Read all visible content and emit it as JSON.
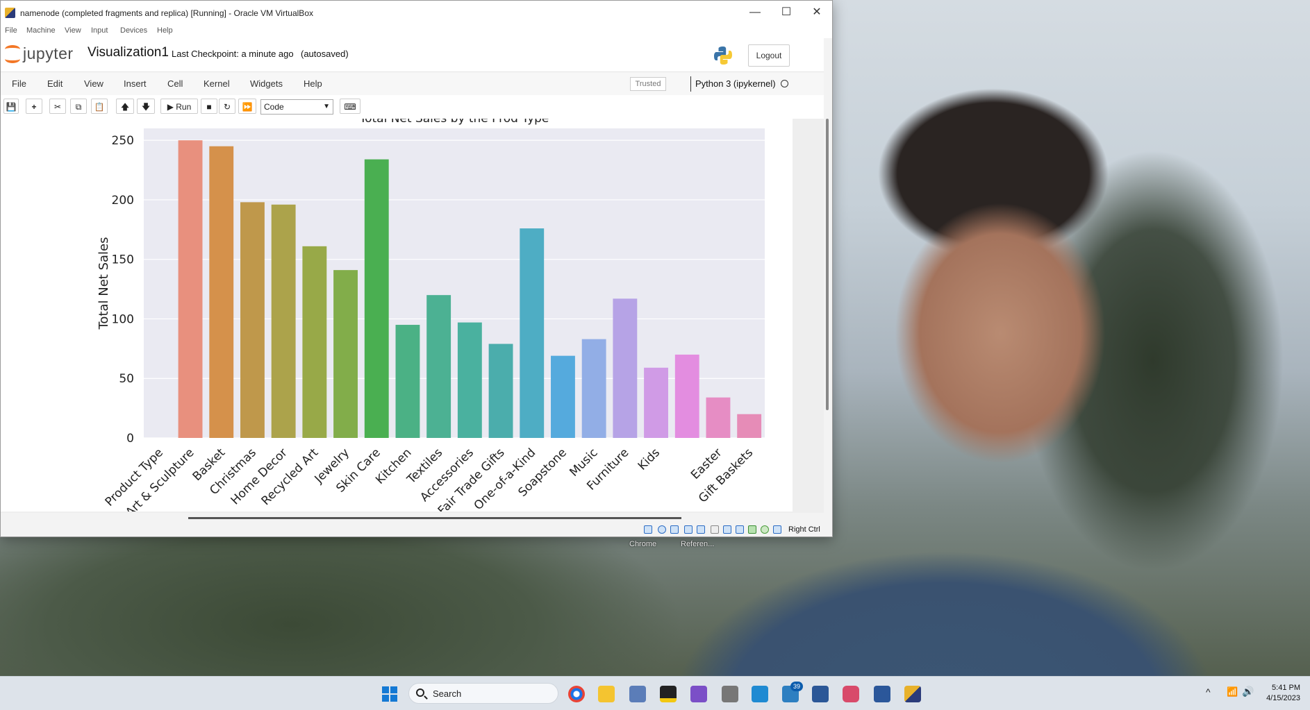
{
  "vbox": {
    "title": "namenode (completed fragments and replica) [Running] - Oracle VM VirtualBox",
    "menu": [
      "File",
      "Machine",
      "View",
      "Input",
      "Devices",
      "Help"
    ],
    "minimize_glyph": "—",
    "maximize_glyph": "☐",
    "close_glyph": "✕",
    "status_host_key": "Right Ctrl"
  },
  "jupyter": {
    "logo_text": "jupyter",
    "notebook_name": "Visualization1",
    "checkpoint": "Last Checkpoint: a minute ago",
    "autosave": "(autosaved)",
    "logout_label": "Logout",
    "menu": [
      "File",
      "Edit",
      "View",
      "Insert",
      "Cell",
      "Kernel",
      "Widgets",
      "Help"
    ],
    "trusted_label": "Trusted",
    "kernel_name": "Python 3 (ipykernel)",
    "toolbar": {
      "save_glyph": "💾",
      "add_glyph": "+",
      "cut_glyph": "✂",
      "copy_glyph": "⧉",
      "paste_glyph": "📋",
      "up_glyph": "🡅",
      "down_glyph": "🡇",
      "run_label": "▶ Run",
      "stop_glyph": "■",
      "restart_glyph": "↻",
      "run_all_glyph": "⏩",
      "cell_type": "Code",
      "keyboard_glyph": "⌨"
    }
  },
  "chart_data": {
    "type": "bar",
    "title": "Total Net Sales by the Prod Type",
    "xlabel": "",
    "ylabel": "Total Net Sales",
    "ylim": [
      0,
      260
    ],
    "yticks": [
      0,
      50,
      100,
      150,
      200,
      250
    ],
    "grid": true,
    "categories": [
      "Product Type",
      "Art & Sculpture",
      "Basket",
      "Christmas",
      "Home Decor",
      "Recycled Art",
      "Jewelry",
      "Skin Care",
      "Kitchen",
      "Textiles",
      "Accessories",
      "Fair Trade Gifts",
      "One-of-a-Kind",
      "Soapstone",
      "Music",
      "Furniture",
      "Kids",
      "",
      "Easter",
      "Gift Baskets"
    ],
    "values": [
      0,
      250,
      245,
      198,
      196,
      161,
      141,
      234,
      95,
      120,
      97,
      79,
      176,
      69,
      83,
      117,
      59,
      70,
      34,
      20
    ],
    "colors": [
      "#e8907e",
      "#e8907e",
      "#d5914b",
      "#bf984b",
      "#aca34b",
      "#98a948",
      "#82ad4a",
      "#4aaf51",
      "#4bb185",
      "#4cb193",
      "#4ab19f",
      "#4badac",
      "#4eadc4",
      "#55aadd",
      "#92aee6",
      "#b6a3e6",
      "#d09be6",
      "#e38de0",
      "#e68dc4",
      "#e68cb7"
    ]
  },
  "desktop": {
    "labels": [
      "Chrome",
      "Referen..."
    ]
  },
  "taskbar": {
    "search_label": "Search",
    "badge_count": "39",
    "time": "5:41 PM",
    "date": "4/15/2023",
    "tray_chevron": "^",
    "wifi_glyph": "📶",
    "volume_glyph": "🔊"
  }
}
